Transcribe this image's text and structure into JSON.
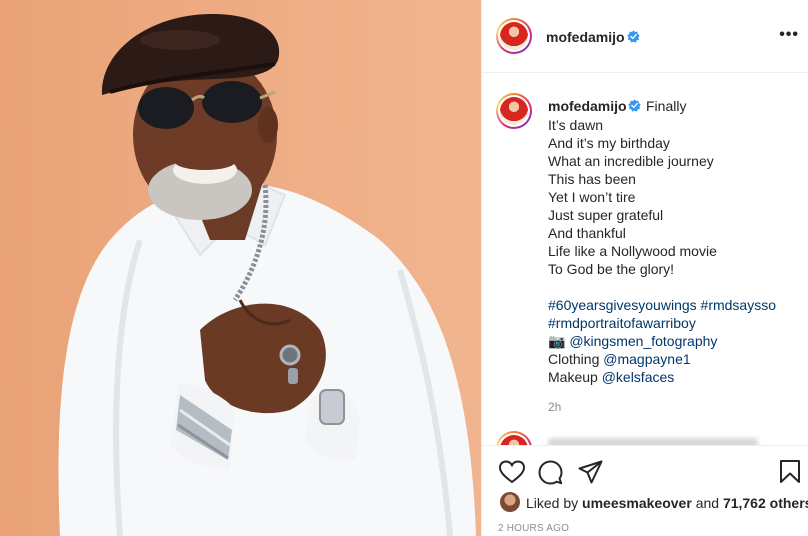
{
  "post": {
    "username": "mofedamijo",
    "verified": true,
    "more_label": "•••",
    "caption_first": "Finally",
    "caption_lines": [
      "It’s dawn",
      "And it’s my birthday",
      "What an incredible journey",
      "This has been",
      "Yet I won’t tire",
      "Just super grateful",
      "And thankful",
      "Life like a Nollywood movie",
      "To God be the glory!"
    ],
    "hashtags_line1": "#60yearsgivesyouwings #rmdsaysso",
    "hashtags_line2": "#rmdportraitofawarriboy",
    "camera_glyph": "📷",
    "photo_credit": "@kingsmen_fotography",
    "clothing_label": "Clothing",
    "clothing_handle": "@magpayne1",
    "makeup_label": "Makeup",
    "makeup_handle": "@kelsfaces",
    "time_ago": "2h",
    "likes_prefix": "Liked by",
    "likes_user": "umeesmakeover",
    "likes_and": "and",
    "likes_count": "71,762 others",
    "timestamp": "2 HOURS AGO"
  },
  "icons": {
    "like": "heart-icon",
    "comment": "comment-icon",
    "share": "paper-plane-icon",
    "save": "bookmark-icon",
    "verified": "verified-badge-icon",
    "more": "more-options-icon"
  },
  "colors": {
    "link": "#00376b",
    "verified": "#3897f0",
    "muted": "#8e8e8e",
    "background_photo": "#eeab82"
  }
}
